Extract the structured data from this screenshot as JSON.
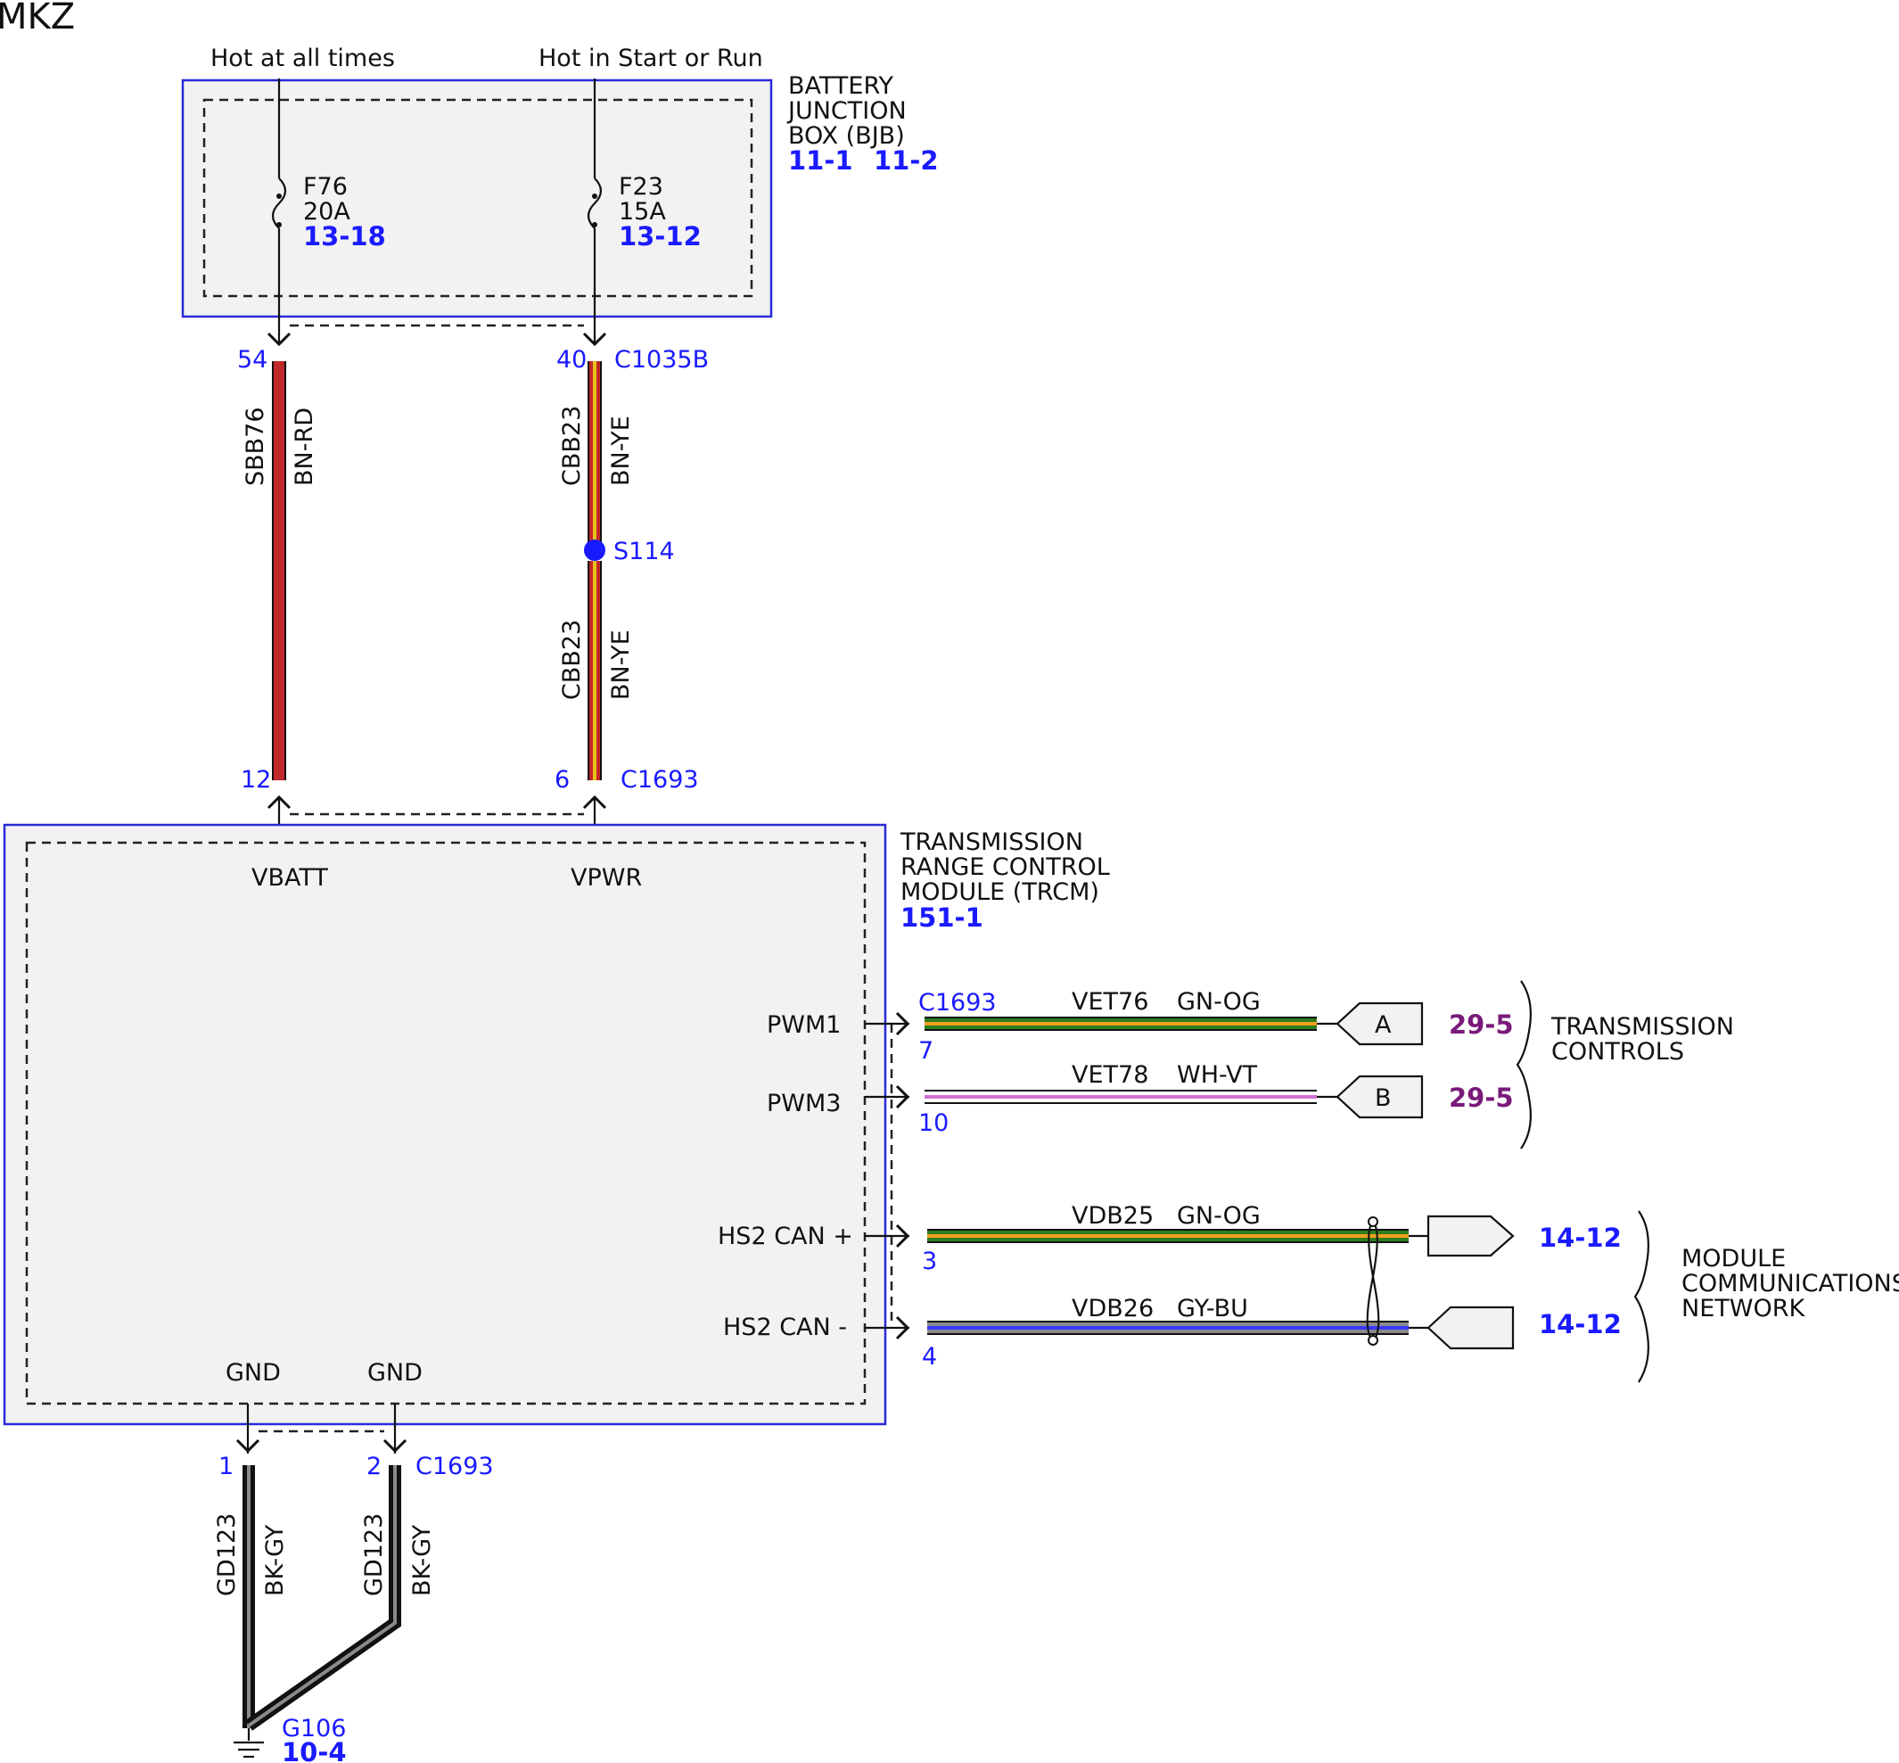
{
  "title": "MKZ",
  "sources": {
    "hot_always": "Hot at all times",
    "hot_start_run": "Hot in Start or Run"
  },
  "bjb": {
    "line1": "BATTERY",
    "line2": "JUNCTION",
    "line3": "BOX (BJB)",
    "ref1": "11-1",
    "ref2": "11-2",
    "fuse1": {
      "name": "F76",
      "rating": "20A",
      "ref": "13-18"
    },
    "fuse2": {
      "name": "F23",
      "rating": "15A",
      "ref": "13-12"
    }
  },
  "wire_sbb76": {
    "pin_top": "54",
    "circuit": "SBB76",
    "color": "BN-RD",
    "pin_bottom": "12",
    "stripe_hex": "#c0282a"
  },
  "wire_cbb23": {
    "pin_top": "40",
    "connector_top": "C1035B",
    "circuit_upper": "CBB23",
    "color_upper": "BN-YE",
    "splice": "S114",
    "circuit_lower": "CBB23",
    "color_lower": "BN-YE",
    "pin_bottom": "6",
    "connector_bottom": "C1693",
    "base_hex": "#c0282a",
    "stripe_hex": "#e8c21a"
  },
  "trcm": {
    "line1": "TRANSMISSION",
    "line2": "RANGE CONTROL",
    "line3": "MODULE (TRCM)",
    "ref": "151-1",
    "vbatt": "VBATT",
    "vpwr": "VPWR",
    "pwm1": "PWM1",
    "pwm3": "PWM3",
    "can_plus": "HS2 CAN +",
    "can_minus": "HS2 CAN -",
    "gnd1": "GND",
    "gnd2": "GND"
  },
  "outputs": {
    "connector": "C1693",
    "vet76": {
      "pin": "7",
      "circuit": "VET76",
      "color": "GN-OG",
      "conn": "A",
      "ref": "29-5"
    },
    "vet78": {
      "pin": "10",
      "circuit": "VET78",
      "color": "WH-VT",
      "conn": "B",
      "ref": "29-5"
    },
    "vdb25": {
      "pin": "3",
      "circuit": "VDB25",
      "color": "GN-OG",
      "ref": "14-12"
    },
    "vdb26": {
      "pin": "4",
      "circuit": "VDB26",
      "color": "GY-BU",
      "ref": "14-12"
    },
    "trans_line1": "TRANSMISSION",
    "trans_line2": "CONTROLS",
    "mcn_line1": "MODULE",
    "mcn_line2": "COMMUNICATIONS",
    "mcn_line3": "NETWORK"
  },
  "ground": {
    "pin1": "1",
    "pin2": "2",
    "connector": "C1693",
    "circuit1": "GD123",
    "color1": "BK-GY",
    "circuit2": "GD123",
    "color2": "BK-GY",
    "point": "G106",
    "ref": "10-4"
  },
  "colors": {
    "green": "#2e7d1e",
    "orange": "#f0a020",
    "white": "#ffffff",
    "violet": "#d070d0",
    "gray": "#8a8a8a",
    "blue": "#3a3aff",
    "black": "#111111",
    "box_border": "#2a2ad8"
  }
}
